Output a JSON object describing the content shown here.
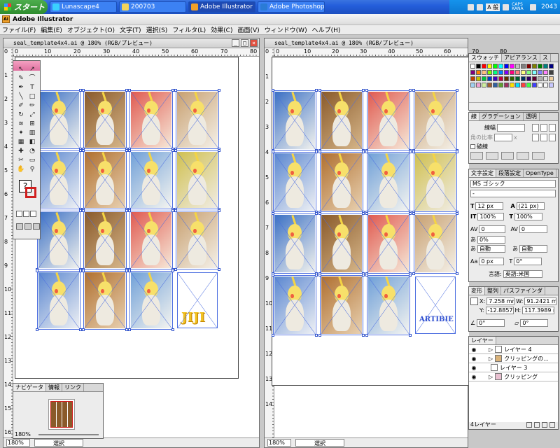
{
  "taskbar": {
    "start_label": "スタート",
    "buttons": [
      {
        "label": "Lunascape4",
        "color": "#3ad0ff"
      },
      {
        "label": "200703",
        "color": "#f3d45c"
      },
      {
        "label": "Adobe Illustrator",
        "color": "#f0a02a"
      },
      {
        "label": "Adobe Photoshop",
        "color": "#2a7bd6"
      }
    ],
    "ime": "A 般",
    "caps": "CAPS KANA",
    "clock": "2043"
  },
  "app": {
    "title": "Adobe Illustrator"
  },
  "menu": [
    "ファイル(F)",
    "編集(E)",
    "オブジェクト(O)",
    "文字(T)",
    "選択(S)",
    "フィルタ(L)",
    "効果(C)",
    "画面(V)",
    "ウィンドウ(W)",
    "ヘルプ(H)"
  ],
  "doc_left": {
    "title": "seal_template4x4.ai @ 180% (RGB/プレビュー)",
    "zoom": "180%",
    "status": "選択",
    "ruler_h": [
      "0",
      "10",
      "20",
      "30",
      "40",
      "50",
      "60",
      "70",
      "80"
    ],
    "ruler_v": [
      "0",
      "1",
      "2",
      "3",
      "4",
      "5",
      "6",
      "7",
      "8",
      "9",
      "10",
      "11",
      "12",
      "13",
      "14",
      "15",
      "16"
    ]
  },
  "doc_right": {
    "title": "seal_template4x4.ai @ 180% (RGB/プレビュー)",
    "zoom": "180%",
    "status": "選択",
    "ruler_h": [
      "0",
      "10",
      "20",
      "30",
      "40",
      "50",
      "60",
      "70",
      "80"
    ],
    "ruler_v": [
      "0",
      "1",
      "2",
      "3",
      "4",
      "5",
      "6",
      "7",
      "8",
      "9",
      "10",
      "11",
      "12",
      "13",
      "14"
    ]
  },
  "artwork": {
    "jiji_text": "JIJI",
    "label_text": "ARTIBIE"
  },
  "navigator": {
    "tabs": [
      "ナビゲータ",
      "情報",
      "リンク"
    ],
    "zoom": "180%"
  },
  "swatches": {
    "tabs": [
      "スウォッチ",
      "アピアランス",
      "ス"
    ],
    "colors": [
      "#ffffff",
      "#000000",
      "#ff0000",
      "#ffff00",
      "#00ff00",
      "#00ffff",
      "#0000ff",
      "#ff00ff",
      "#c0c0c0",
      "#808080",
      "#800000",
      "#808000",
      "#008000",
      "#008080",
      "#000080",
      "#800080",
      "#ff8000",
      "#ffc080",
      "#80ff00",
      "#00ff80",
      "#0080ff",
      "#8000ff",
      "#ff0080",
      "#ff8080",
      "#ffff80",
      "#80ff80",
      "#80ffff",
      "#8080ff",
      "#ff80ff",
      "#404040",
      "#c04000",
      "#c0c000",
      "#00c040",
      "#0040c0",
      "#4000c0",
      "#c00040",
      "#603000",
      "#306000",
      "#006030",
      "#003060",
      "#300060",
      "#600030",
      "#b0b0b0",
      "#e0e0e0",
      "#f0d0a0",
      "#a0d0f0",
      "#f0a0d0",
      "#d0f0a0",
      "#a06030",
      "#3060a0",
      "#60a030",
      "#a03060",
      "#ffe000",
      "#00e0ff",
      "#ff4040",
      "#40ff40",
      "#4040ff",
      "#ffffff",
      "#f8f8f8",
      "#c8c8ff"
    ]
  },
  "stroke": {
    "tabs": [
      "線",
      "グラデーション",
      "透明"
    ],
    "weight_label": "線幅",
    "miter_label": "角の比率",
    "dash_label": "破線",
    "miter_unit": "x"
  },
  "character": {
    "tabs": [
      "文字設定",
      "段落設定",
      "OpenType"
    ],
    "font": "MS ゴシック",
    "style": "-",
    "size": "12 px",
    "leading": "(21 px)",
    "hscale": "100%",
    "vscale": "100%",
    "kern": "0",
    "track": "0",
    "tsume": "0%",
    "auto1": "自動",
    "auto2": "自動",
    "baseline": "0 px",
    "rotate": "0°",
    "lang_label": "言語:",
    "lang": "英語:米国"
  },
  "transform": {
    "tabs": [
      "変形",
      "整列",
      "パスファインダ"
    ],
    "x_label": "X:",
    "x": "7.258 mm",
    "y_label": "Y:",
    "y": "-12.8857 m",
    "w_label": "W:",
    "w": "91.2421 mm",
    "h_label": "H:",
    "h": "117.3989 mm",
    "rot": "0°",
    "shear": "0°"
  },
  "layers": {
    "tab": "レイヤー",
    "rows": [
      "レイヤー 4",
      "クリッピングの...",
      "レイヤー 3",
      "クリッピング"
    ],
    "footer": "4レイヤー"
  }
}
